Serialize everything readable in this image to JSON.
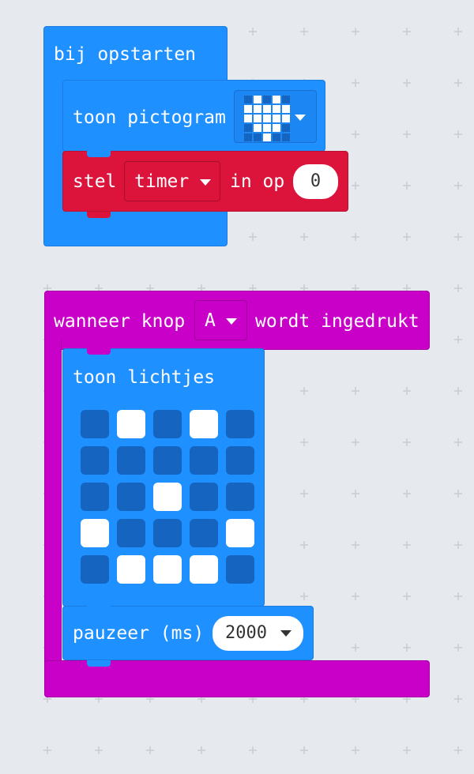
{
  "on_start": {
    "header_label": "bij opstarten",
    "show_icon_label": "toon pictogram",
    "icon_name": "heart-icon",
    "icon_pattern": [
      [
        0,
        1,
        0,
        1,
        0
      ],
      [
        1,
        1,
        1,
        1,
        1
      ],
      [
        1,
        1,
        1,
        1,
        1
      ],
      [
        0,
        1,
        1,
        1,
        0
      ],
      [
        0,
        0,
        1,
        0,
        0
      ]
    ],
    "set_label": "stel",
    "variable_name": "timer",
    "to_label": "in op",
    "set_value": "0"
  },
  "on_button": {
    "when_label": "wanneer knop",
    "button_value": "A",
    "pressed_label": "wordt ingedrukt",
    "show_leds_label": "toon lichtjes",
    "leds": [
      [
        0,
        1,
        0,
        1,
        0
      ],
      [
        0,
        0,
        0,
        0,
        0
      ],
      [
        0,
        0,
        1,
        0,
        0
      ],
      [
        1,
        0,
        0,
        0,
        1
      ],
      [
        0,
        1,
        1,
        1,
        0
      ]
    ],
    "pause_label": "pauzeer (ms)",
    "pause_value": "2000"
  },
  "colors": {
    "workspace": "#e6e9ed",
    "basic_block": "#1e90ff",
    "variables_block": "#dc143c",
    "input_block": "#c800c8",
    "led_on": "#ffffff",
    "led_off": "#1565c0"
  }
}
